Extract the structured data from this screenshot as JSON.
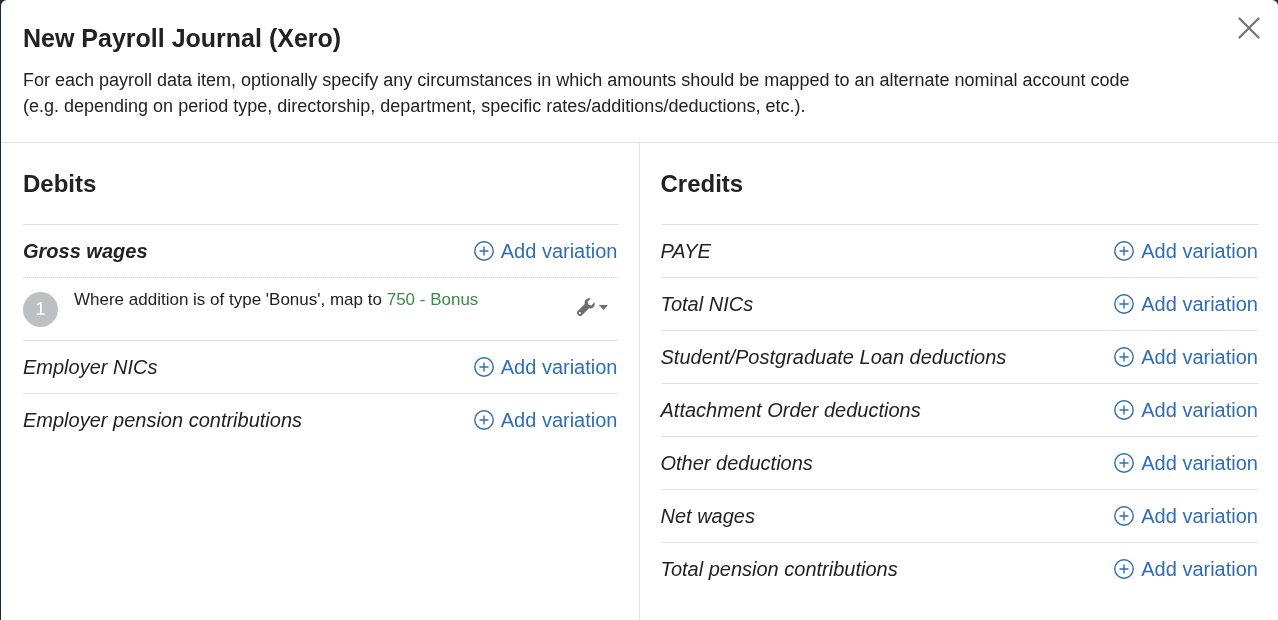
{
  "dialog": {
    "title": "New Payroll Journal (Xero)",
    "description": "For each payroll data item, optionally specify any circumstances in which amounts should be mapped to an alternate nominal account code (e.g. depending on period type, directorship, department, specific rates/additions/deductions, etc.)."
  },
  "sections": [
    {
      "heading": "Debits",
      "items": [
        {
          "label": "Gross wages",
          "action": "Add variation",
          "variations": [
            {
              "number": "1",
              "text": "Where addition is of type 'Bonus', map to",
              "account": "750 - Bonus"
            }
          ]
        },
        {
          "label": "Employer NICs",
          "action": "Add variation"
        },
        {
          "label": "Employer pension contributions",
          "action": "Add variation"
        }
      ]
    },
    {
      "heading": "Credits",
      "items": [
        {
          "label": "PAYE",
          "action": "Add variation"
        },
        {
          "label": "Total NICs",
          "action": "Add variation"
        },
        {
          "label": "Student/Postgraduate Loan deductions",
          "action": "Add variation"
        },
        {
          "label": "Attachment Order deductions",
          "action": "Add variation"
        },
        {
          "label": "Other deductions",
          "action": "Add variation"
        },
        {
          "label": "Net wages",
          "action": "Add variation"
        },
        {
          "label": "Total pension contributions",
          "action": "Add variation"
        }
      ]
    }
  ]
}
